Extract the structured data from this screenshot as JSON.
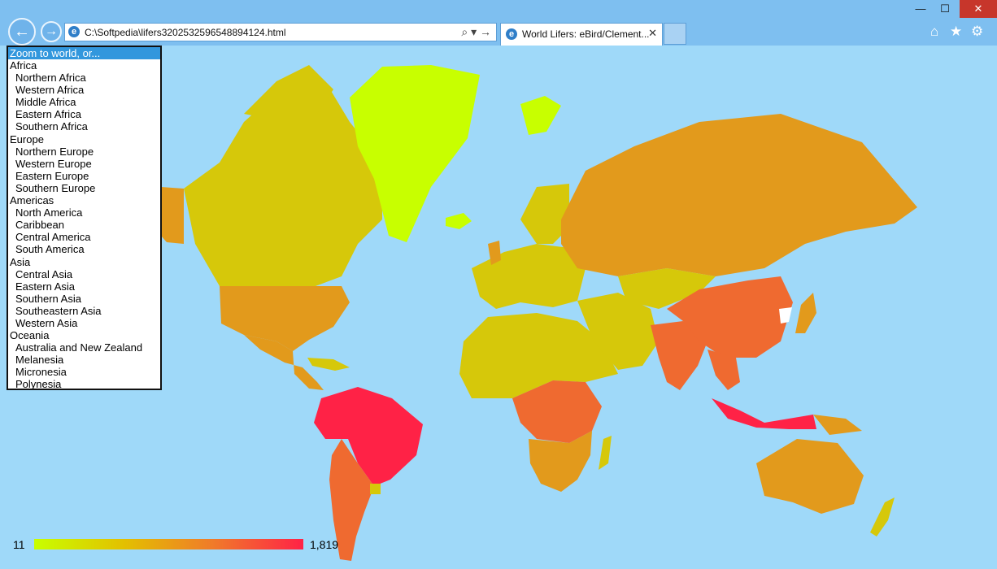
{
  "browser": {
    "address": "C:\\Softpedia\\lifers3202532596548894124.html",
    "tab_title": "World Lifers: eBird/Clement...",
    "tab_close": "✕",
    "back_glyph": "←",
    "forward_glyph": "→",
    "address_tools": "⌕ ▾ →",
    "home_glyph": "⌂",
    "favorites_glyph": "★",
    "settings_glyph": "⚙",
    "min_glyph": "—",
    "max_glyph": "☐",
    "close_glyph": "✕"
  },
  "region_select": {
    "selected": "Zoom to world, or...",
    "options": [
      {
        "label": "Africa",
        "level": "group"
      },
      {
        "label": "Northern Africa",
        "level": "sub"
      },
      {
        "label": "Western Africa",
        "level": "sub"
      },
      {
        "label": "Middle Africa",
        "level": "sub"
      },
      {
        "label": "Eastern Africa",
        "level": "sub"
      },
      {
        "label": "Southern Africa",
        "level": "sub"
      },
      {
        "label": "Europe",
        "level": "group"
      },
      {
        "label": "Northern Europe",
        "level": "sub"
      },
      {
        "label": "Western Europe",
        "level": "sub"
      },
      {
        "label": "Eastern Europe",
        "level": "sub"
      },
      {
        "label": "Southern Europe",
        "level": "sub"
      },
      {
        "label": "Americas",
        "level": "group"
      },
      {
        "label": "North America",
        "level": "sub"
      },
      {
        "label": "Caribbean",
        "level": "sub"
      },
      {
        "label": "Central America",
        "level": "sub"
      },
      {
        "label": "South America",
        "level": "sub"
      },
      {
        "label": "Asia",
        "level": "group"
      },
      {
        "label": "Central Asia",
        "level": "sub"
      },
      {
        "label": "Eastern Asia",
        "level": "sub"
      },
      {
        "label": "Southern Asia",
        "level": "sub"
      },
      {
        "label": "Southeastern Asia",
        "level": "sub"
      },
      {
        "label": "Western Asia",
        "level": "sub"
      },
      {
        "label": "Oceania",
        "level": "group"
      },
      {
        "label": "Australia and New Zealand",
        "level": "sub"
      },
      {
        "label": "Melanesia",
        "level": "sub"
      },
      {
        "label": "Micronesia",
        "level": "sub"
      },
      {
        "label": "Polynesia",
        "level": "sub"
      }
    ]
  },
  "legend": {
    "min": "11",
    "max": "1,819"
  },
  "colors": {
    "ocean": "#9fd9f9",
    "low": "#c8ff00",
    "mid_low": "#d6c80a",
    "mid": "#e29a1c",
    "mid_high": "#ef6a30",
    "high": "#ff2246"
  }
}
